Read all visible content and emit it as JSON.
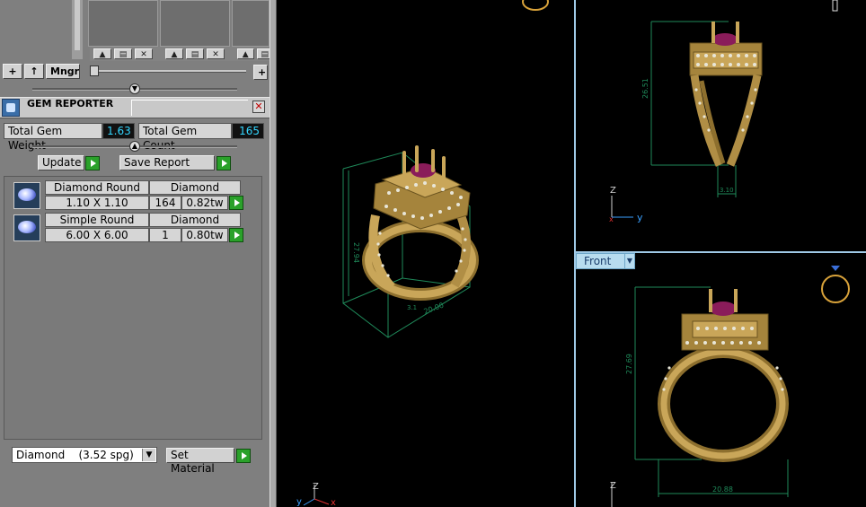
{
  "toolbar": {
    "add_label": "+",
    "up_label": "↑",
    "manager_label": "Mngr",
    "zoom_plus_label": "+"
  },
  "gem_reporter": {
    "title": "GEM REPORTER",
    "close_label": "✕",
    "total_weight_label": "Total Gem Weight",
    "total_weight_value": "1.63",
    "total_count_label": "Total Gem Count",
    "total_count_value": "165",
    "update_label": "Update",
    "save_report_label": "Save Report",
    "rows": [
      {
        "name": "Diamond Round",
        "size": "1.10 X 1.10",
        "material": "Diamond",
        "count": "164",
        "weight": "0.82tw"
      },
      {
        "name": "Simple Round",
        "size": "6.00 X 6.00",
        "material": "Diamond",
        "count": "1",
        "weight": "0.80tw"
      }
    ],
    "material_select": {
      "value": "Diamond",
      "spg": "(3.52 spg)"
    },
    "set_material_label": "Set Material"
  },
  "viewports": {
    "main": {
      "dim_height": "27.94",
      "dim_width": "20.00",
      "dim_small": "3.1",
      "axis_z": "Z",
      "axis_y": "y",
      "axis_x": "x"
    },
    "side": {
      "dim_height": "26.51",
      "dim_width": "3.10",
      "axis_z": "Z",
      "axis_y": "y",
      "axis_x": "x"
    },
    "front": {
      "label": "Front",
      "dim_height": "27.69",
      "dim_width": "20.88",
      "axis_z": "Z"
    }
  },
  "colors": {
    "gold": "#b8974a",
    "gem": "#8a1c5a",
    "dim": "#1f8a5a",
    "accent": "#33d6ff"
  }
}
